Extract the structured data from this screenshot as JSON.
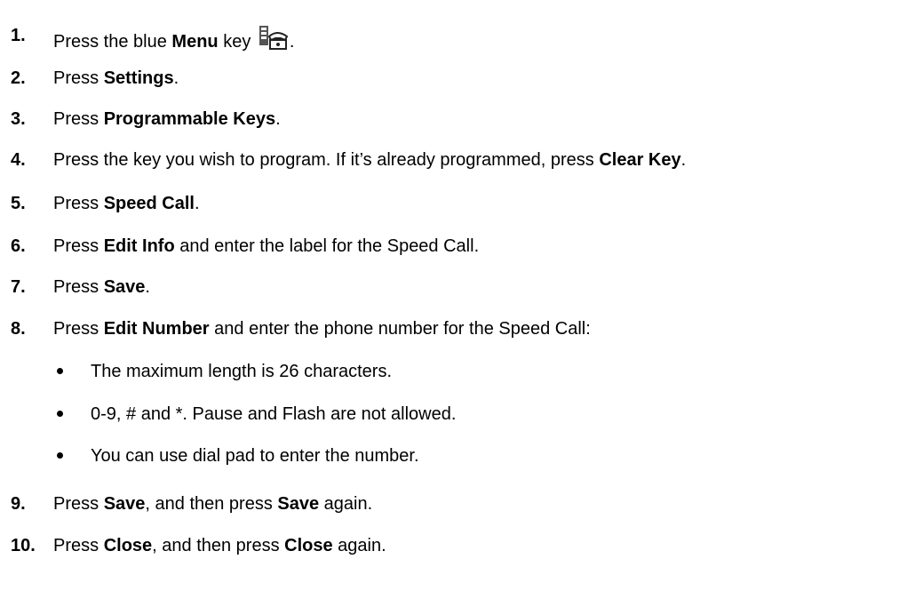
{
  "steps": [
    {
      "num": "1.",
      "parts": [
        {
          "t": "Press the blue "
        },
        {
          "t": "Menu",
          "b": true
        },
        {
          "t": " key "
        },
        {
          "icon": "menu-key-icon"
        },
        {
          "t": "."
        }
      ]
    },
    {
      "num": "2.",
      "parts": [
        {
          "t": "Press "
        },
        {
          "t": "Settings",
          "b": true
        },
        {
          "t": "."
        }
      ]
    },
    {
      "num": "3.",
      "parts": [
        {
          "t": "Press "
        },
        {
          "t": "Programmable Keys",
          "b": true
        },
        {
          "t": "."
        }
      ]
    },
    {
      "num": "4.",
      "parts": [
        {
          "t": "Press the key you wish to program. If it’s already programmed, press "
        },
        {
          "t": "Clear Key",
          "b": true
        },
        {
          "t": "."
        }
      ]
    },
    {
      "num": "5.",
      "parts": [
        {
          "t": "Press "
        },
        {
          "t": "Speed Call",
          "b": true
        },
        {
          "t": "."
        }
      ]
    },
    {
      "num": "6.",
      "parts": [
        {
          "t": "Press "
        },
        {
          "t": "Edit Info",
          "b": true
        },
        {
          "t": " and enter the label for the Speed Call."
        }
      ]
    },
    {
      "num": "7.",
      "parts": [
        {
          "t": "Press "
        },
        {
          "t": "Save",
          "b": true
        },
        {
          "t": "."
        }
      ]
    },
    {
      "num": "8.",
      "parts": [
        {
          "t": "Press "
        },
        {
          "t": "Edit Number",
          "b": true
        },
        {
          "t": " and enter the phone number for the Speed Call:"
        }
      ]
    },
    {
      "num": "9.",
      "parts": [
        {
          "t": "Press "
        },
        {
          "t": "Save",
          "b": true
        },
        {
          "t": ", and then press "
        },
        {
          "t": "Save",
          "b": true
        },
        {
          "t": " again."
        }
      ]
    },
    {
      "num": "10.",
      "parts": [
        {
          "t": "Press "
        },
        {
          "t": "Close",
          "b": true
        },
        {
          "t": ", and then press "
        },
        {
          "t": "Close",
          "b": true
        },
        {
          "t": " again."
        }
      ]
    }
  ],
  "bullets": [
    "The maximum length is 26 characters.",
    "0-9, # and *. Pause and Flash are not allowed.",
    "You can use dial pad to enter the number."
  ]
}
